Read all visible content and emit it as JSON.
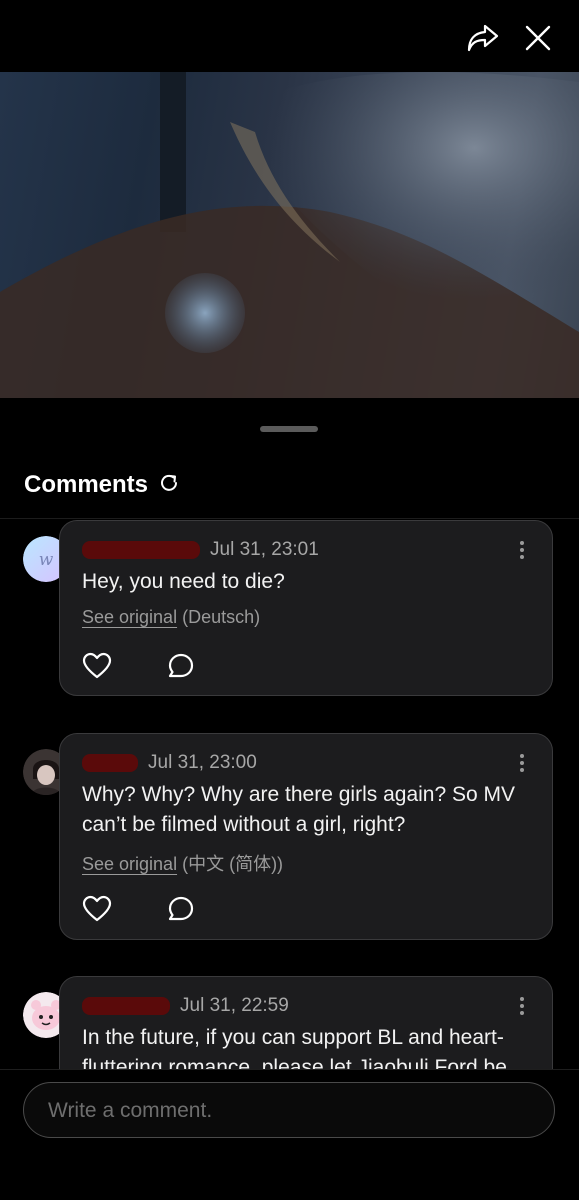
{
  "icons": {
    "share": "share-forward-icon",
    "close": "close-icon"
  },
  "comments": {
    "title": "Comments",
    "refresh_icon": "refresh-icon",
    "items": [
      {
        "time": "Jul 31, 23:01",
        "text": "Hey, you need to die?",
        "see_original": "See original",
        "language": "(Deutsch)"
      },
      {
        "time": "Jul 31, 23:00",
        "text": "Why? Why? Why are there girls again? So MV can’t be filmed without a girl, right?",
        "see_original": "See original",
        "language": "(中文 (简体))"
      },
      {
        "time": "Jul 31, 22:59",
        "text": "In the future, if you can support BL and heart-fluttering romance, please let Jiaobuli Ford be"
      }
    ]
  },
  "composer": {
    "placeholder": "Write a comment."
  }
}
